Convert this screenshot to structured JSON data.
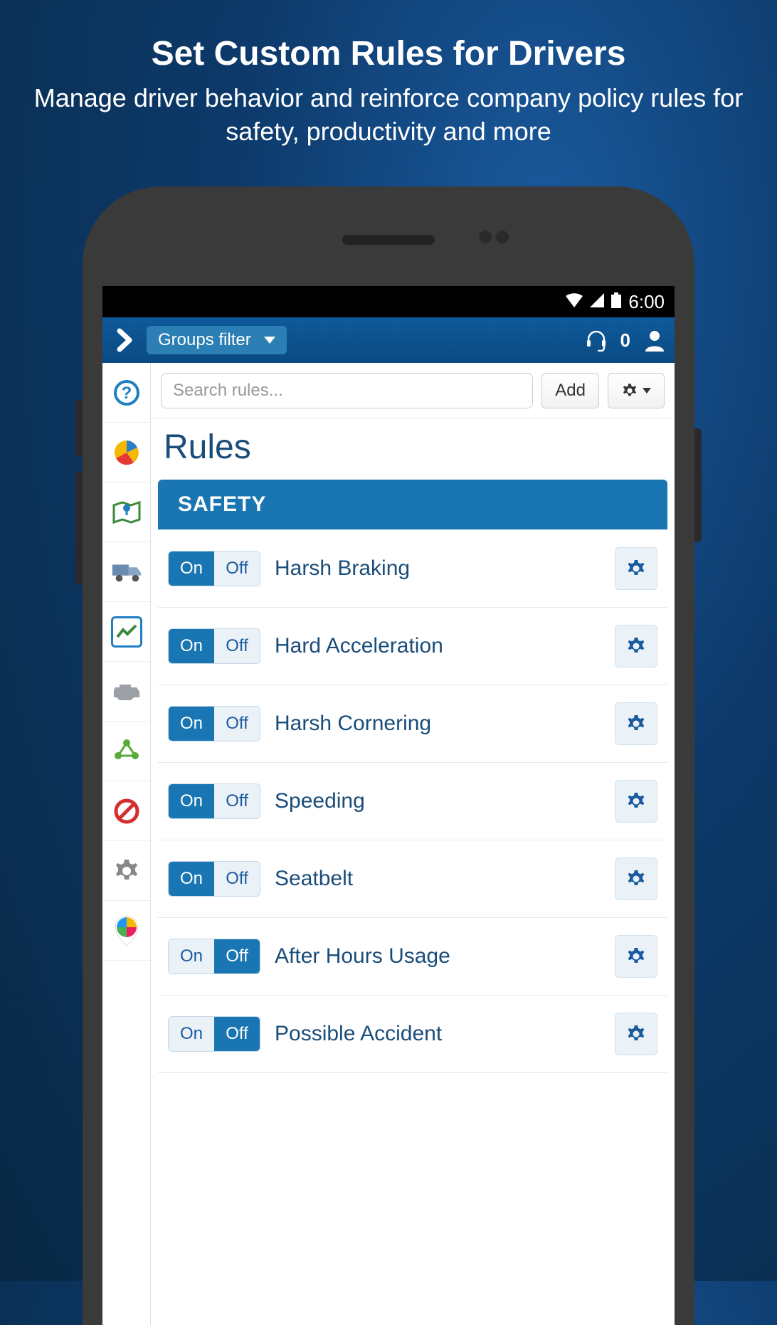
{
  "promo": {
    "title": "Set Custom Rules for Drivers",
    "subtitle": "Manage driver behavior and reinforce company policy rules for safety, productivity and more"
  },
  "status": {
    "time": "6:00"
  },
  "header": {
    "groups_filter_label": "Groups filter",
    "notification_count": "0"
  },
  "toolbar": {
    "search_placeholder": "Search rules...",
    "add_label": "Add"
  },
  "page": {
    "title": "Rules"
  },
  "section": {
    "title": "SAFETY"
  },
  "toggle": {
    "on": "On",
    "off": "Off"
  },
  "rules": [
    {
      "name": "Harsh Braking",
      "state": "on"
    },
    {
      "name": "Hard Acceleration",
      "state": "on"
    },
    {
      "name": "Harsh Cornering",
      "state": "on"
    },
    {
      "name": "Speeding",
      "state": "on"
    },
    {
      "name": "Seatbelt",
      "state": "on"
    },
    {
      "name": "After Hours Usage",
      "state": "off"
    },
    {
      "name": "Possible Accident",
      "state": "off"
    }
  ],
  "sidebar": {
    "items": [
      {
        "id": "help"
      },
      {
        "id": "dashboard"
      },
      {
        "id": "map"
      },
      {
        "id": "vehicles"
      },
      {
        "id": "activity",
        "active": true
      },
      {
        "id": "engine"
      },
      {
        "id": "zones"
      },
      {
        "id": "exceptions"
      },
      {
        "id": "settings"
      },
      {
        "id": "marketplace"
      }
    ]
  }
}
